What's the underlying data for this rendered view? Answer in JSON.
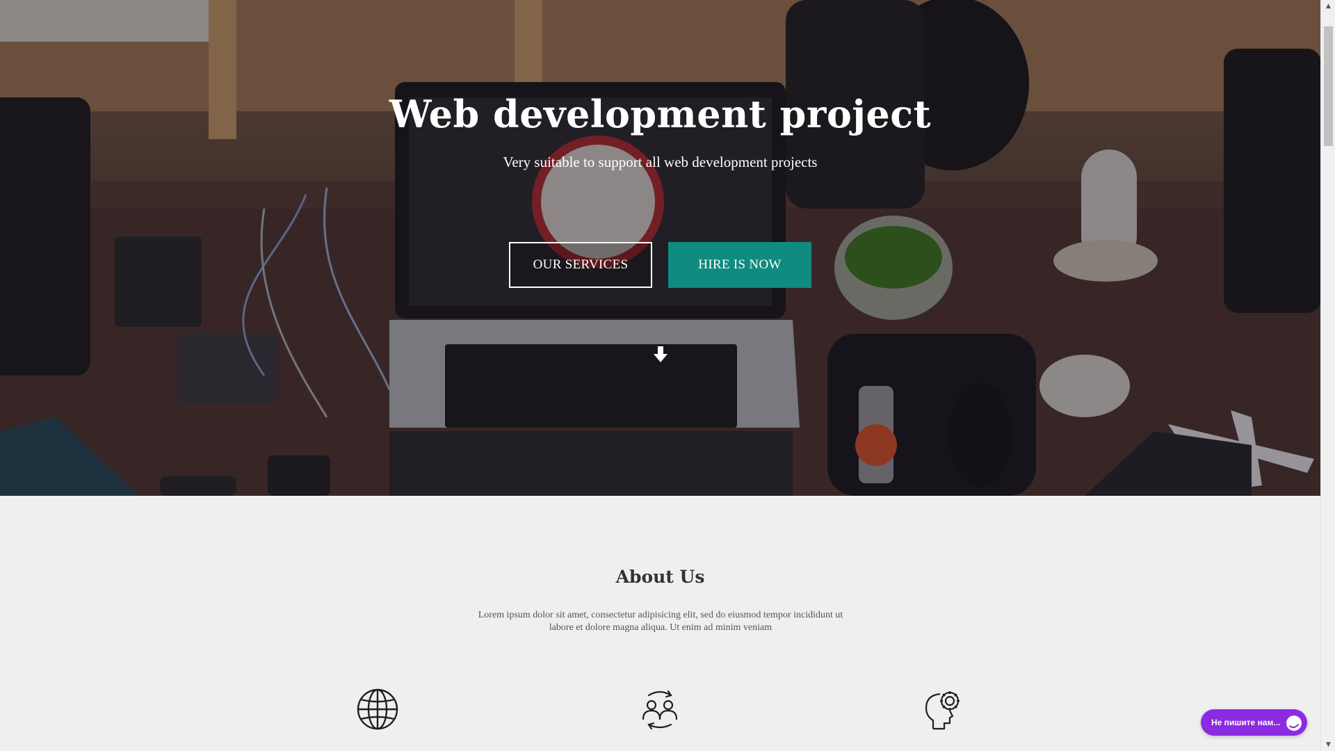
{
  "hero": {
    "title": "Web development project",
    "subtitle": "Very suitable to support all web development projects",
    "primary_button": "OUR SERVICES",
    "secondary_button": "HIRE IS NOW",
    "accent_color": "#0f8b7f",
    "scroll_icon": "arrow-down-icon"
  },
  "about": {
    "title": "About Us",
    "text": "Lorem ipsum dolor sit amet, consectetur adipisicing elit, sed do eiusmod tempor incididunt ut labore et dolore magna aliqua. Ut enim ad minim veniam",
    "features": [
      {
        "icon": "globe-icon"
      },
      {
        "icon": "user-exchange-icon"
      },
      {
        "icon": "head-gear-icon"
      }
    ]
  },
  "chat": {
    "label": "Не пишите нам...",
    "color": "#8a2be2",
    "icon": "chat-bubble-icon"
  },
  "scrollbar": {
    "up_icon": "▲",
    "down_icon": "▼"
  }
}
